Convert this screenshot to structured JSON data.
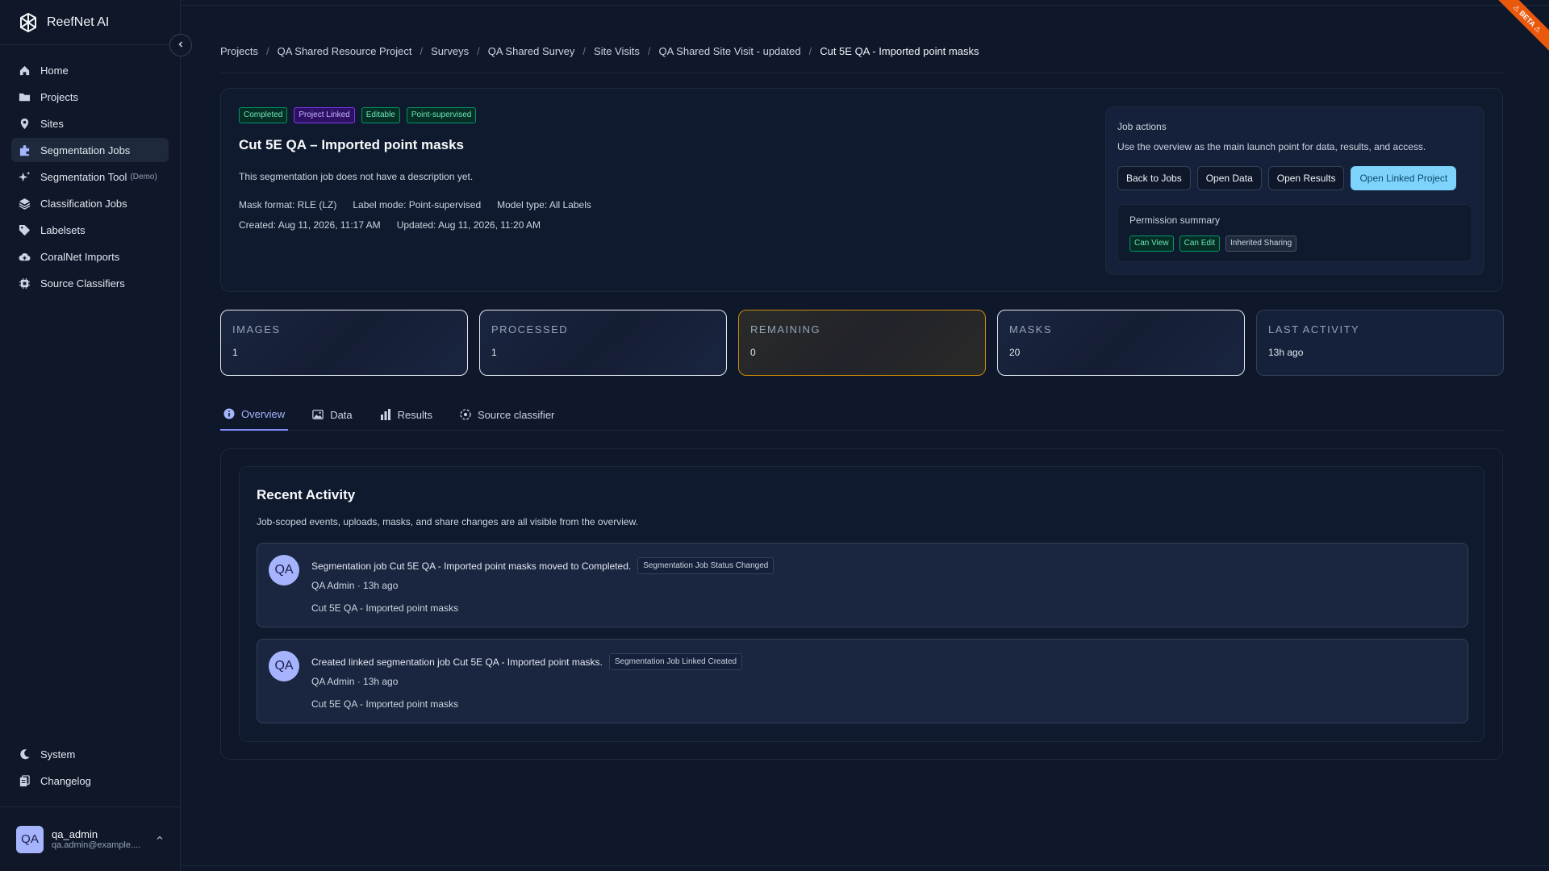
{
  "app": {
    "name": "ReefNet AI",
    "beta_label": "BETA"
  },
  "sidebar": {
    "items": [
      {
        "label": "Home",
        "icon": "home-icon"
      },
      {
        "label": "Projects",
        "icon": "folder-icon"
      },
      {
        "label": "Sites",
        "icon": "map-pin-icon"
      },
      {
        "label": "Segmentation Jobs",
        "icon": "puzzle-icon",
        "active": true
      },
      {
        "label": "Segmentation Tool",
        "sub": "(Demo)",
        "icon": "sparkles-icon"
      },
      {
        "label": "Classification Jobs",
        "icon": "layers-icon"
      },
      {
        "label": "Labelsets",
        "icon": "tag-icon"
      },
      {
        "label": "CoralNet Imports",
        "icon": "cloud-upload-icon"
      },
      {
        "label": "Source Classifiers",
        "icon": "cpu-icon"
      }
    ],
    "bottom": [
      {
        "label": "System",
        "icon": "moon-icon"
      },
      {
        "label": "Changelog",
        "icon": "changelog-icon"
      }
    ],
    "user": {
      "initials": "QA",
      "name": "qa_admin",
      "email": "qa.admin@example...."
    }
  },
  "breadcrumb": [
    "Projects",
    "QA Shared Resource Project",
    "Surveys",
    "QA Shared Survey",
    "Site Visits",
    "QA Shared Site Visit - updated",
    "Cut 5E QA - Imported point masks"
  ],
  "job": {
    "badges": [
      "Completed",
      "Project Linked",
      "Editable",
      "Point-supervised"
    ],
    "title": "Cut 5E QA – Imported point masks",
    "description": "This segmentation job does not have a description yet.",
    "mask_format": "Mask format: RLE (LZ)",
    "label_mode": "Label mode: Point-supervised",
    "model_type": "Model type: All Labels",
    "created": "Created: Aug 11, 2026, 11:17 AM",
    "updated": "Updated: Aug 11, 2026, 11:20 AM"
  },
  "actions": {
    "title": "Job actions",
    "description": "Use the overview as the main launch point for data, results, and access.",
    "buttons": [
      "Back to Jobs",
      "Open Data",
      "Open Results",
      "Open Linked Project"
    ],
    "permission_title": "Permission summary",
    "permissions": [
      "Can View",
      "Can Edit",
      "Inherited Sharing"
    ]
  },
  "stats": [
    {
      "label": "IMAGES",
      "value": "1"
    },
    {
      "label": "PROCESSED",
      "value": "1"
    },
    {
      "label": "REMAINING",
      "value": "0"
    },
    {
      "label": "MASKS",
      "value": "20"
    },
    {
      "label": "LAST ACTIVITY",
      "value": "13h ago"
    }
  ],
  "tabs": [
    {
      "label": "Overview",
      "icon": "info-icon"
    },
    {
      "label": "Data",
      "icon": "image-icon"
    },
    {
      "label": "Results",
      "icon": "bar-chart-icon"
    },
    {
      "label": "Source classifier",
      "icon": "target-icon"
    }
  ],
  "activity": {
    "title": "Recent Activity",
    "description": "Job-scoped events, uploads, masks, and share changes are all visible from the overview.",
    "items": [
      {
        "initials": "QA",
        "text": "Segmentation job Cut 5E QA - Imported point masks moved to Completed.",
        "tag": "Segmentation Job Status Changed",
        "meta": "QA Admin · 13h ago",
        "subject": "Cut 5E QA - Imported point masks"
      },
      {
        "initials": "QA",
        "text": "Created linked segmentation job Cut 5E QA - Imported point masks.",
        "tag": "Segmentation Job Linked Created",
        "meta": "QA Admin · 13h ago",
        "subject": "Cut 5E QA - Imported point masks"
      }
    ]
  },
  "colors": {
    "background": "#0f172a",
    "accent": "#818cf8",
    "primary_button": "#7dd3fc",
    "success": "#059669",
    "warning": "#ca8a04"
  }
}
